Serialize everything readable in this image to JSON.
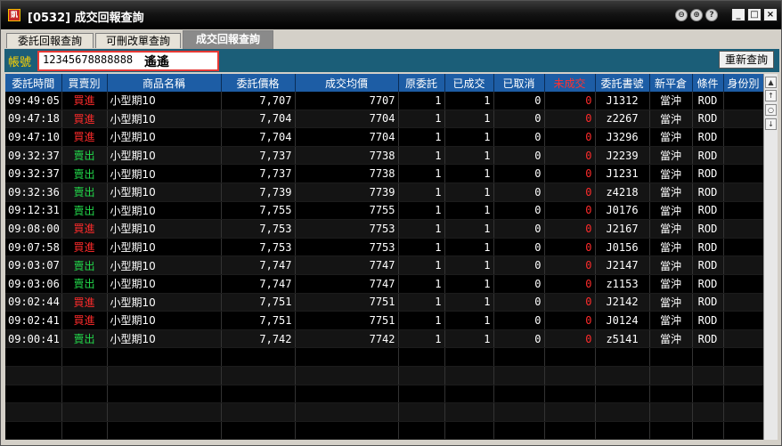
{
  "window": {
    "icon_text": "凱",
    "title": "[0532] 成交回報查詢",
    "buttons": [
      "⊖",
      "⊕",
      "?",
      "_",
      "□",
      "×"
    ]
  },
  "tabs": [
    {
      "label": "委託回報查詢"
    },
    {
      "label": "可刪改單查詢"
    },
    {
      "label": "成交回報查詢"
    }
  ],
  "account": {
    "label": "帳號",
    "number": "12345678888888",
    "name": "遙遙",
    "refresh_label": "重新查詢"
  },
  "colors": {
    "buy": "#ff2b2b",
    "sell": "#22d84a",
    "header_bg": "#1d5da5",
    "account_bar_bg": "#1b5e78",
    "account_label": "#ffd400"
  },
  "table": {
    "columns": [
      "委託時間",
      "買賣別",
      "商品名稱",
      "委託價格",
      "成交均價",
      "原委託",
      "已成交",
      "已取消",
      "未成交",
      "委託書號",
      "新平倉",
      "條件",
      "身份別"
    ],
    "rows": [
      {
        "time": "09:49:05",
        "side": "買進",
        "product": "小型期10",
        "price": "7,707",
        "avg": "7707",
        "orig": "1",
        "filled": "1",
        "cancel": "0",
        "unfilled": "0",
        "order_no": "J1312",
        "oc": "當沖",
        "cond": "ROD",
        "id": ""
      },
      {
        "time": "09:47:18",
        "side": "買進",
        "product": "小型期10",
        "price": "7,704",
        "avg": "7704",
        "orig": "1",
        "filled": "1",
        "cancel": "0",
        "unfilled": "0",
        "order_no": "z2267",
        "oc": "當沖",
        "cond": "ROD",
        "id": ""
      },
      {
        "time": "09:47:10",
        "side": "買進",
        "product": "小型期10",
        "price": "7,704",
        "avg": "7704",
        "orig": "1",
        "filled": "1",
        "cancel": "0",
        "unfilled": "0",
        "order_no": "J3296",
        "oc": "當沖",
        "cond": "ROD",
        "id": ""
      },
      {
        "time": "09:32:37",
        "side": "賣出",
        "product": "小型期10",
        "price": "7,737",
        "avg": "7738",
        "orig": "1",
        "filled": "1",
        "cancel": "0",
        "unfilled": "0",
        "order_no": "J2239",
        "oc": "當沖",
        "cond": "ROD",
        "id": ""
      },
      {
        "time": "09:32:37",
        "side": "賣出",
        "product": "小型期10",
        "price": "7,737",
        "avg": "7738",
        "orig": "1",
        "filled": "1",
        "cancel": "0",
        "unfilled": "0",
        "order_no": "J1231",
        "oc": "當沖",
        "cond": "ROD",
        "id": ""
      },
      {
        "time": "09:32:36",
        "side": "賣出",
        "product": "小型期10",
        "price": "7,739",
        "avg": "7739",
        "orig": "1",
        "filled": "1",
        "cancel": "0",
        "unfilled": "0",
        "order_no": "z4218",
        "oc": "當沖",
        "cond": "ROD",
        "id": ""
      },
      {
        "time": "09:12:31",
        "side": "賣出",
        "product": "小型期10",
        "price": "7,755",
        "avg": "7755",
        "orig": "1",
        "filled": "1",
        "cancel": "0",
        "unfilled": "0",
        "order_no": "J0176",
        "oc": "當沖",
        "cond": "ROD",
        "id": ""
      },
      {
        "time": "09:08:00",
        "side": "買進",
        "product": "小型期10",
        "price": "7,753",
        "avg": "7753",
        "orig": "1",
        "filled": "1",
        "cancel": "0",
        "unfilled": "0",
        "order_no": "J2167",
        "oc": "當沖",
        "cond": "ROD",
        "id": ""
      },
      {
        "time": "09:07:58",
        "side": "買進",
        "product": "小型期10",
        "price": "7,753",
        "avg": "7753",
        "orig": "1",
        "filled": "1",
        "cancel": "0",
        "unfilled": "0",
        "order_no": "J0156",
        "oc": "當沖",
        "cond": "ROD",
        "id": ""
      },
      {
        "time": "09:03:07",
        "side": "賣出",
        "product": "小型期10",
        "price": "7,747",
        "avg": "7747",
        "orig": "1",
        "filled": "1",
        "cancel": "0",
        "unfilled": "0",
        "order_no": "J2147",
        "oc": "當沖",
        "cond": "ROD",
        "id": ""
      },
      {
        "time": "09:03:06",
        "side": "賣出",
        "product": "小型期10",
        "price": "7,747",
        "avg": "7747",
        "orig": "1",
        "filled": "1",
        "cancel": "0",
        "unfilled": "0",
        "order_no": "z1153",
        "oc": "當沖",
        "cond": "ROD",
        "id": ""
      },
      {
        "time": "09:02:44",
        "side": "買進",
        "product": "小型期10",
        "price": "7,751",
        "avg": "7751",
        "orig": "1",
        "filled": "1",
        "cancel": "0",
        "unfilled": "0",
        "order_no": "J2142",
        "oc": "當沖",
        "cond": "ROD",
        "id": ""
      },
      {
        "time": "09:02:41",
        "side": "買進",
        "product": "小型期10",
        "price": "7,751",
        "avg": "7751",
        "orig": "1",
        "filled": "1",
        "cancel": "0",
        "unfilled": "0",
        "order_no": "J0124",
        "oc": "當沖",
        "cond": "ROD",
        "id": ""
      },
      {
        "time": "09:00:41",
        "side": "賣出",
        "product": "小型期10",
        "price": "7,742",
        "avg": "7742",
        "orig": "1",
        "filled": "1",
        "cancel": "0",
        "unfilled": "0",
        "order_no": "z5141",
        "oc": "當沖",
        "cond": "ROD",
        "id": ""
      }
    ],
    "empty_rows": 6
  },
  "scrollbar": {
    "buttons": [
      "▲",
      "↑",
      "○",
      "↓"
    ]
  }
}
